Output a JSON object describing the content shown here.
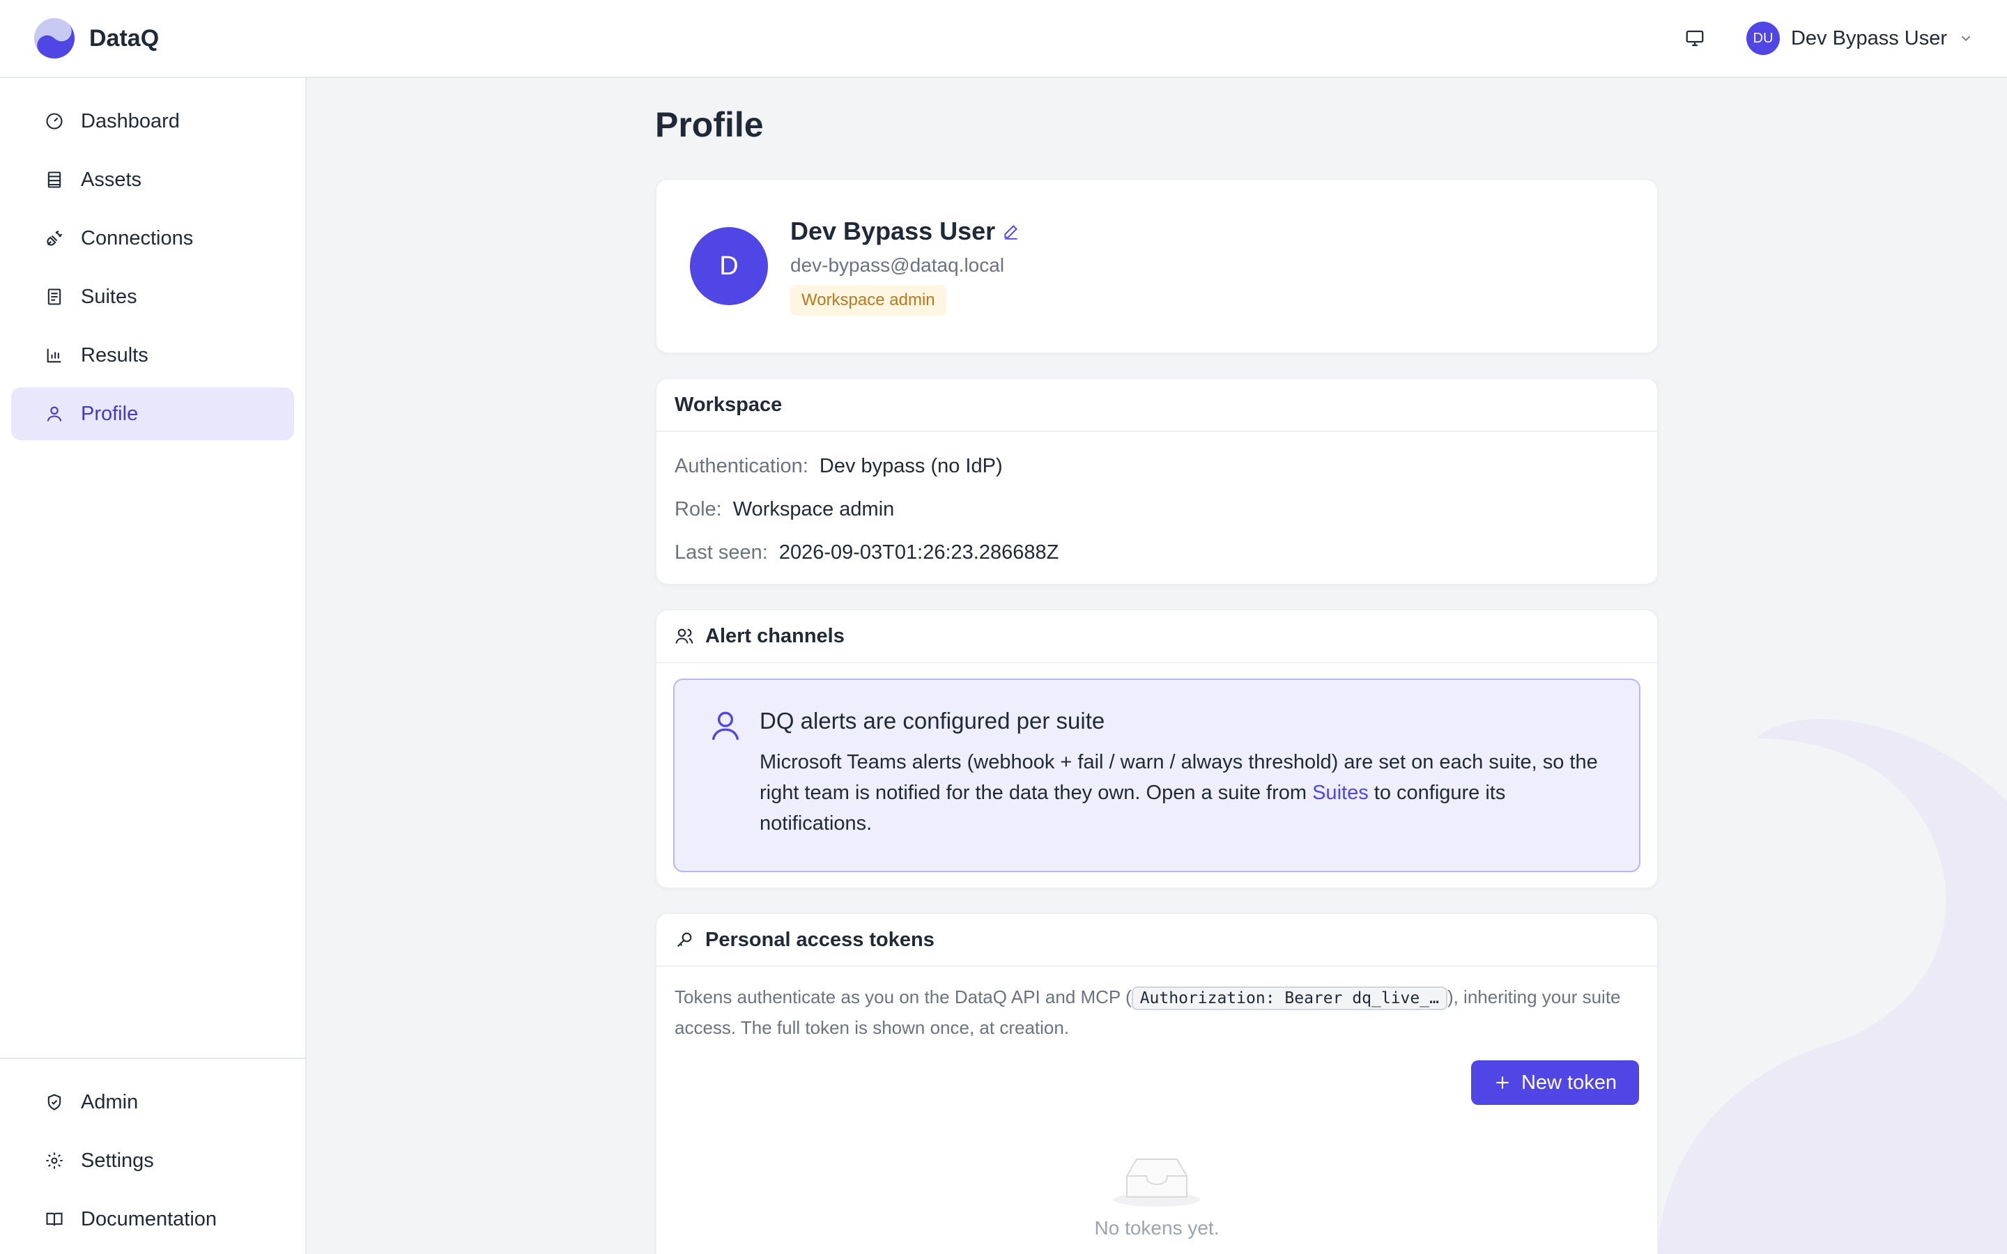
{
  "app": {
    "name": "DataQ"
  },
  "header": {
    "user_initials": "DU",
    "user_name": "Dev Bypass User"
  },
  "sidebar": {
    "items": [
      {
        "label": "Dashboard",
        "icon": "gauge-icon"
      },
      {
        "label": "Assets",
        "icon": "table-icon"
      },
      {
        "label": "Connections",
        "icon": "plug-icon"
      },
      {
        "label": "Suites",
        "icon": "checklist-icon"
      },
      {
        "label": "Results",
        "icon": "bar-chart-icon"
      },
      {
        "label": "Profile",
        "icon": "user-icon",
        "active": true
      }
    ],
    "bottom_items": [
      {
        "label": "Admin",
        "icon": "shield-icon"
      },
      {
        "label": "Settings",
        "icon": "gear-icon"
      },
      {
        "label": "Documentation",
        "icon": "book-icon"
      }
    ]
  },
  "page": {
    "title": "Profile"
  },
  "profile": {
    "initial": "D",
    "name": "Dev Bypass User",
    "email": "dev-bypass@dataq.local",
    "role_badge": "Workspace admin"
  },
  "workspace": {
    "title": "Workspace",
    "auth_label": "Authentication",
    "auth_value": "Dev bypass (no IdP)",
    "role_label": "Role",
    "role_value": "Workspace admin",
    "last_seen_label": "Last seen",
    "last_seen_value": "2026-09-03T01:26:23.286688Z"
  },
  "alerts": {
    "title": "Alert channels",
    "notice_title": "DQ alerts are configured per suite",
    "notice_text_before": "Microsoft Teams alerts (webhook + fail / warn / always threshold) are set on each suite, so the right team is notified for the data they own. Open a suite from ",
    "notice_link": "Suites",
    "notice_text_after": " to configure its notifications."
  },
  "tokens": {
    "title": "Personal access tokens",
    "desc_before": "Tokens authenticate as you on the DataQ API and MCP (",
    "desc_code": "Authorization: Bearer dq_live_…",
    "desc_after": "), inheriting your suite access. The full token is shown once, at creation.",
    "new_button": "New token",
    "empty_text": "No tokens yet."
  },
  "colors": {
    "accent": "#4f46e5",
    "active_bg": "#e8e7fc",
    "badge_bg": "#fef6e0",
    "badge_text": "#b7791f"
  }
}
